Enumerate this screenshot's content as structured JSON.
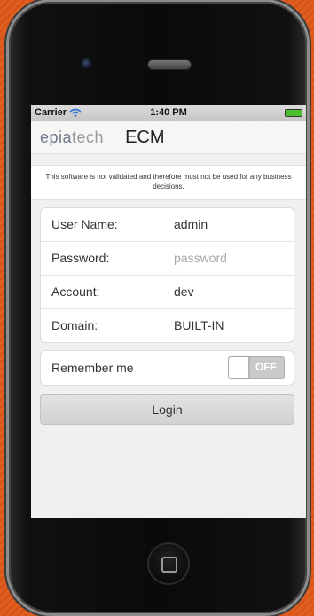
{
  "status_bar": {
    "carrier": "Carrier",
    "time": "1:40 PM",
    "wifi_icon": "wifi-icon",
    "battery_color": "#4cbf2f"
  },
  "header": {
    "logo_text_part1": "epia",
    "logo_text_part2": "tech",
    "title": "ECM"
  },
  "disclaimer": "This software is not validated and therefore must not be used for any business decisions.",
  "form": {
    "fields": [
      {
        "label": "User Name:",
        "value": "admin"
      },
      {
        "label": "Password:",
        "placeholder": "password"
      },
      {
        "label": "Account:",
        "value": "dev"
      },
      {
        "label": "Domain:",
        "value": "BUILT-IN"
      }
    ]
  },
  "remember": {
    "label": "Remember me",
    "toggle_state": "OFF"
  },
  "login_label": "Login",
  "colors": {
    "background_accent": "#d9541a",
    "toggle_off": "#c9c9c9"
  }
}
